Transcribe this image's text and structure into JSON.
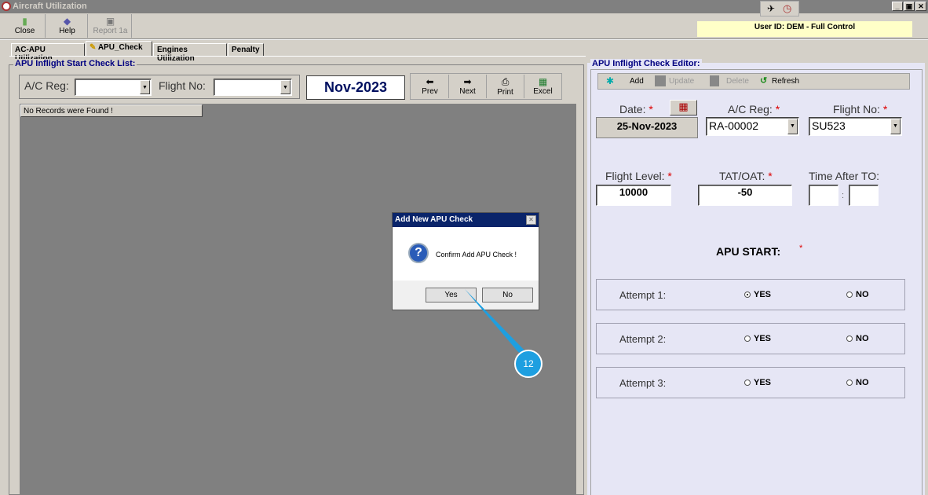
{
  "window": {
    "title": "Aircraft Utilization",
    "min": "_",
    "max": "▣",
    "close": "✕"
  },
  "toolbar": {
    "close": "Close",
    "help": "Help",
    "report": "Report 1a"
  },
  "user_info": "User ID: DEM - Full Control",
  "tabs": [
    "AC-APU Utilization",
    "APU_Check",
    "Engines Utilization",
    "Penalty"
  ],
  "list_panel": {
    "title": "APU Inflight Start Check List:",
    "ac_reg_label": "A/C Reg:",
    "flight_no_label": "Flight No:",
    "ac_reg_value": "",
    "flight_no_value": "",
    "period": "Nov-2023",
    "prev": "Prev",
    "next": "Next",
    "print": "Print",
    "excel": "Excel",
    "no_records": "No Records were Found !"
  },
  "editor": {
    "title": "APU Inflight Check Editor:",
    "add": "Add",
    "update": "Update",
    "delete": "Delete",
    "refresh": "Refresh",
    "date_label": "Date:",
    "date_value": "25-Nov-2023",
    "ac_reg_label": "A/C Reg:",
    "ac_reg_value": "RA-00002",
    "flight_no_label": "Flight No:",
    "flight_no_value": "SU523",
    "flight_level_label": "Flight Level:",
    "flight_level_value": "10000",
    "tat_label": "TAT/OAT:",
    "tat_value": "-50",
    "time_label": "Time After TO:",
    "time_h": "",
    "time_sep": ":",
    "time_m": "",
    "apu_start_label": "APU START:",
    "req": "*",
    "attempts": [
      {
        "label": "Attempt 1:",
        "yes": "YES",
        "no": "NO"
      },
      {
        "label": "Attempt 2:",
        "yes": "YES",
        "no": "NO"
      },
      {
        "label": "Attempt 3:",
        "yes": "YES",
        "no": "NO"
      }
    ]
  },
  "dialog": {
    "title": "Add New APU Check",
    "message": "Confirm Add APU Check !",
    "yes": "Yes",
    "no": "No",
    "close": "✕"
  },
  "callout": {
    "step": "12"
  }
}
